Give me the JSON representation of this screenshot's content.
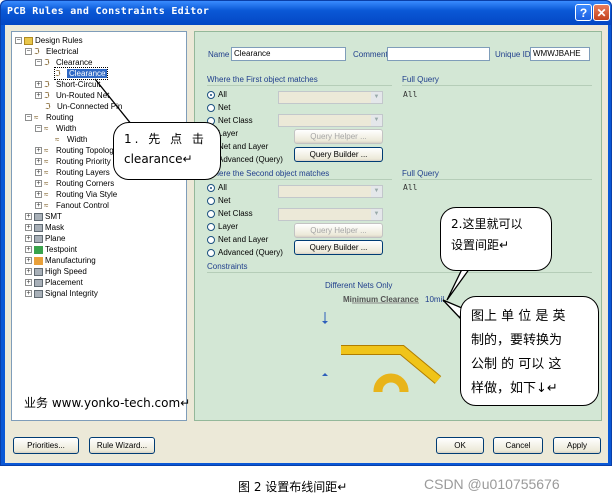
{
  "window": {
    "title": "PCB Rules and Constraints Editor",
    "help_glyph": "?",
    "close_glyph": "✕"
  },
  "tree": {
    "root": "Design Rules",
    "electrical": "Electrical",
    "clearance": "Clearance",
    "clearance_child": "Clearance",
    "short_circuit": "Short-Circuit",
    "unrouted_net": "Un-Routed Net",
    "unconnected_pin": "Un-Connected Pin",
    "routing": "Routing",
    "width": "Width",
    "width_child": "Width",
    "routing_topology": "Routing Topology",
    "routing_priority": "Routing Priority",
    "routing_layers": "Routing Layers",
    "routing_corners": "Routing Corners",
    "routing_via_style": "Routing Via Style",
    "fanout_control": "Fanout Control",
    "smt": "SMT",
    "mask": "Mask",
    "plane": "Plane",
    "testpoint": "Testpoint",
    "manufacturing": "Manufacturing",
    "high_speed": "High Speed",
    "placement": "Placement",
    "signal_integrity": "Signal Integrity"
  },
  "rule": {
    "name_label": "Name",
    "name_value": "Clearance",
    "comment_label": "Comment",
    "comment_value": "",
    "uid_label": "Unique ID",
    "uid_value": "WMWJBAHE"
  },
  "first": {
    "title": "Where the First object matches",
    "opt_all": "All",
    "opt_net": "Net",
    "opt_netclass": "Net Class",
    "opt_layer": "Layer",
    "opt_netlayer": "Net and Layer",
    "opt_advanced": "Advanced (Query)",
    "query_helper": "Query Helper ...",
    "query_builder": "Query Builder ...",
    "full_query_label": "Full Query",
    "full_query_value": "All"
  },
  "second": {
    "title": "Where the Second object matches",
    "opt_all": "All",
    "opt_net": "Net",
    "opt_netclass": "Net Class",
    "opt_layer": "Layer",
    "opt_netlayer": "Net and Layer",
    "opt_advanced": "Advanced (Query)",
    "query_helper": "Query Helper ...",
    "query_builder": "Query Builder ...",
    "full_query_label": "Full Query",
    "full_query_value": "All"
  },
  "constraints": {
    "title": "Constraints",
    "different_nets": "Different Nets Only",
    "min_clearance_label": "Minimum Clearance",
    "min_clearance_value": "10mil"
  },
  "buttons": {
    "priorities": "Priorities...",
    "rule_wizard": "Rule Wizard...",
    "ok": "OK",
    "cancel": "Cancel",
    "apply": "Apply"
  },
  "callouts": {
    "c1_line1": "1. 先 点 击",
    "c1_line2": "clearance↵",
    "c2_line1": "2.这里就可以",
    "c2_line2": "设置间距↵",
    "c3_line1": "图上 单 位 是 英",
    "c3_line2": "制的，要转换为",
    "c3_line3": "公制 的 可以 这",
    "c3_line4": "样做，如下↓↵"
  },
  "overlay_text": "业务 www.yonko-tech.com↵",
  "caption": "图 2 设置布线间距↵",
  "watermark": "CSDN @u010755676",
  "colors": {
    "titlebar": "#0a58d6",
    "panel": "#d3e7d5",
    "selected": "#316ac5",
    "track": "#e8b41a"
  }
}
